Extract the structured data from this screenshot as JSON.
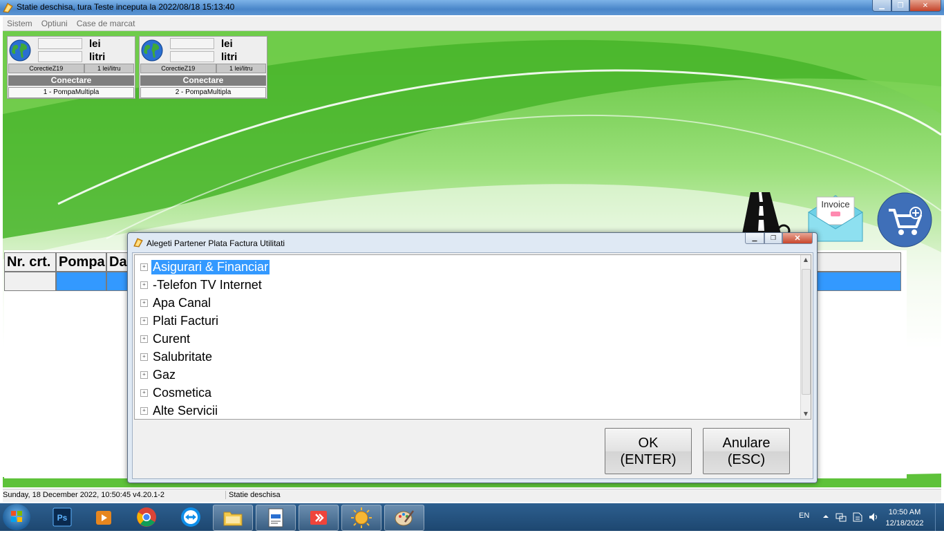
{
  "window": {
    "title": "Statie deschisa, tura Teste inceputa la 2022/08/18 15:13:40"
  },
  "menu": [
    "Sistem",
    "Optiuni",
    "Case de marcat"
  ],
  "pumps": [
    {
      "unit_money": "lei",
      "unit_volume": "litri",
      "correction": "CorectieZ19",
      "price": "1 lei/litru",
      "connect": "Conectare",
      "name": "1 - PompaMultipla"
    },
    {
      "unit_money": "lei",
      "unit_volume": "litri",
      "correction": "CorectieZ19",
      "price": "1 lei/litru",
      "connect": "Conectare",
      "name": "2 - PompaMultipla"
    }
  ],
  "right_icons": {
    "invoice_label": "Invoice"
  },
  "table": {
    "headers": [
      "Nr. crt.",
      "Pompa",
      "Da"
    ]
  },
  "dialog": {
    "title": "Alegeti Partener Plata Factura Utilitati",
    "items": [
      {
        "label": "Asigurari & Financiar",
        "selected": true
      },
      {
        "label": "-Telefon TV Internet",
        "selected": false
      },
      {
        "label": "Apa Canal",
        "selected": false
      },
      {
        "label": "Plati Facturi",
        "selected": false
      },
      {
        "label": "Curent",
        "selected": false
      },
      {
        "label": "Salubritate",
        "selected": false
      },
      {
        "label": "Gaz",
        "selected": false
      },
      {
        "label": "Cosmetica",
        "selected": false
      },
      {
        "label": "Alte Servicii",
        "selected": false
      }
    ],
    "ok": {
      "line1": "OK",
      "line2": "(ENTER)"
    },
    "cancel": {
      "line1": "Anulare",
      "line2": "(ESC)"
    }
  },
  "status": {
    "datetime": "Sunday, 18 December 2022, 10:50:45 v4.20.1-2",
    "state": "Statie deschisa"
  },
  "taskbar": {
    "language": "EN",
    "time": "10:50 AM",
    "date": "12/18/2022"
  },
  "colors": {
    "selection": "#3399ff",
    "row_highlight": "#3399ff",
    "taskbar": "#1d4770"
  }
}
